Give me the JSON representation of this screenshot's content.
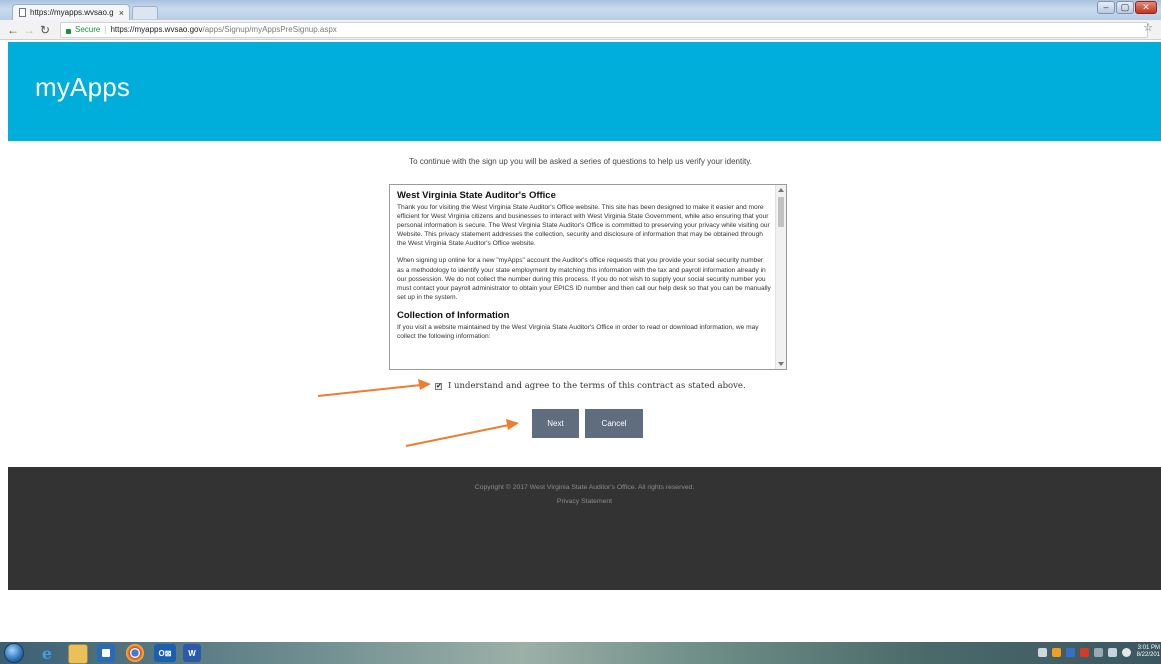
{
  "browser": {
    "tab_title": "https://myapps.wvsao.g",
    "tab_close": "×",
    "security_label": "Secure",
    "url_separator": "|",
    "url_host": "https://myapps.wvsao.gov",
    "url_path": "/apps/Signup/myAppsPreSignup.aspx"
  },
  "header": {
    "brand": "myApps",
    "color": "#00aedb"
  },
  "intro_text": "To continue with the sign up you will be asked a series of questions to help us verify your identity.",
  "terms": {
    "heading": "West Virginia State Auditor's Office",
    "paragraph1": "Thank you for visiting the West Virginia State Auditor's Office website. This site has been designed to make it easier and more efficient for West Virginia citizens and businesses to interact with West Virginia State Government, while also ensuring that your personal information is secure. The West Virginia State Auditor's Office is committed to preserving your privacy while visiting our Website. This privacy statement addresses the collection, security and disclosure of information that may be obtained through the West Virginia State Auditor's Office website.",
    "paragraph2": "When signing up online for a new \"myApps\" account the Auditor's office requests that you provide your social security number as a methodology to identify your state employment by matching this information with the tax and payroll information already in our possession. We do not collect the number during this process. If you do not wish to supply your social security number you must contact your payroll administrator to obtain your EPICS ID number and then call our help desk so that you can be manually set up in the system.",
    "heading2": "Collection of Information",
    "paragraph3": "If you visit a website maintained by the West Virginia State Auditor's Office in order to read or download information, we may collect the following information:"
  },
  "agreement": {
    "checked": true,
    "check_mark": "✔",
    "label": "I understand and agree to the terms of this contract as stated above."
  },
  "buttons": {
    "next": "Next",
    "cancel": "Cancel",
    "color": "#5f6d7e"
  },
  "footer": {
    "copyright": "Copyright © 2017 West Virginia State Auditor's Office. All rights reserved.",
    "privacy": "Privacy Statement"
  },
  "annotation_color": "#ed7d31",
  "taskbar": {
    "apps": [
      "internet-explorer-icon",
      "file-explorer-icon",
      "outlook-icon",
      "chrome-icon",
      "outlook-icon-2",
      "word-icon"
    ],
    "outlook_label": "O⊠",
    "word_label": "W",
    "clock_time": "3:01 PM",
    "clock_date": "8/22/201"
  }
}
